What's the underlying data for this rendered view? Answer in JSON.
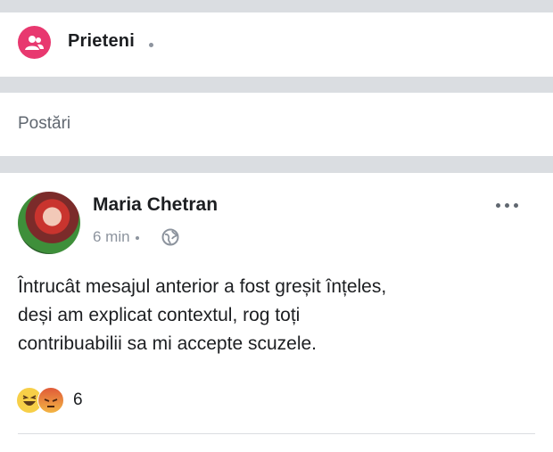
{
  "friends": {
    "label": "Prieteni"
  },
  "posts_section": {
    "label": "Postări"
  },
  "post": {
    "author": "Maria Chetran",
    "time": "6 min",
    "text_lines": [
      "Întrucât mesajul anterior a fost greșit înțeles,",
      "deși am explicat contextul, rog toți",
      "contribuabilii sa mi accepte scuzele."
    ],
    "reaction_count": "6"
  },
  "colors": {
    "accent": "#e8386f",
    "text": "#1c1e21",
    "muted": "#8d949e",
    "background": "#dadde1"
  },
  "icons": [
    "friends-icon",
    "globe-icon",
    "more-options-icon",
    "haha-reaction-icon",
    "angry-reaction-icon"
  ]
}
